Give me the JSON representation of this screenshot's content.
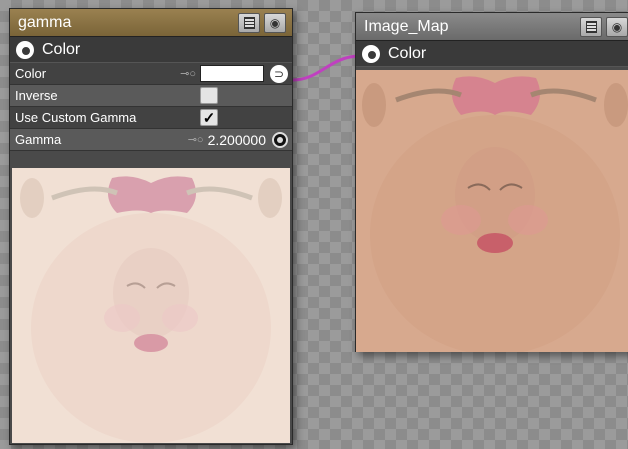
{
  "gamma_node": {
    "title": "gamma",
    "output_label": "Color",
    "properties": {
      "color_label": "Color",
      "inverse_label": "Inverse",
      "use_custom_gamma_label": "Use Custom Gamma",
      "use_custom_gamma_checked": "✓",
      "gamma_label": "Gamma",
      "gamma_value": "2.200000"
    }
  },
  "image_node": {
    "title": "Image_Map",
    "output_label": "Color"
  },
  "colors": {
    "connection": "#c040c0",
    "gamma_title_bg": "#8a7040",
    "image_title_bg": "#7a7a7a",
    "swatch": "#ffffff"
  }
}
